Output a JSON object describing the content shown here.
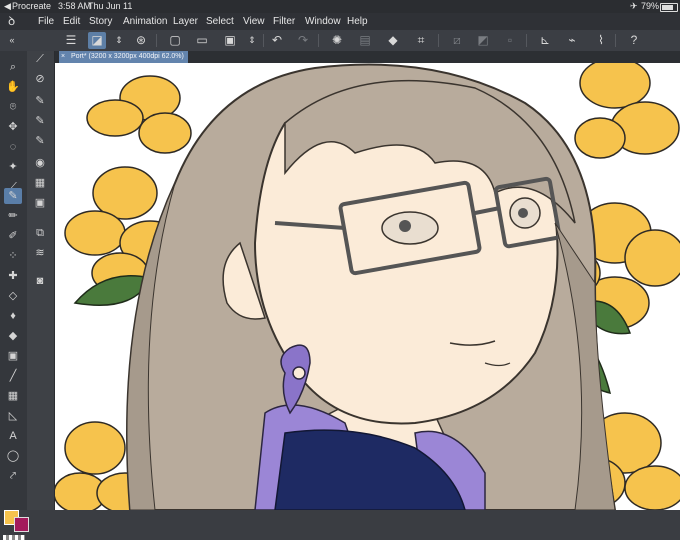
{
  "status_bar": {
    "app": "Procreate",
    "time": "3:58 AM",
    "date": "Thu Jun 11",
    "battery": "79%"
  },
  "menu": {
    "items": [
      "File",
      "Edit",
      "Story",
      "Animation",
      "Layer",
      "Select",
      "View",
      "Filter",
      "Window",
      "Help"
    ]
  },
  "tab": {
    "title": "Port* (3200 x 3200px 400dpi 62.0%)"
  },
  "colors": {
    "main": "#f6c34d",
    "sub": "#a31a5b",
    "accent": "#5d7fa6"
  }
}
